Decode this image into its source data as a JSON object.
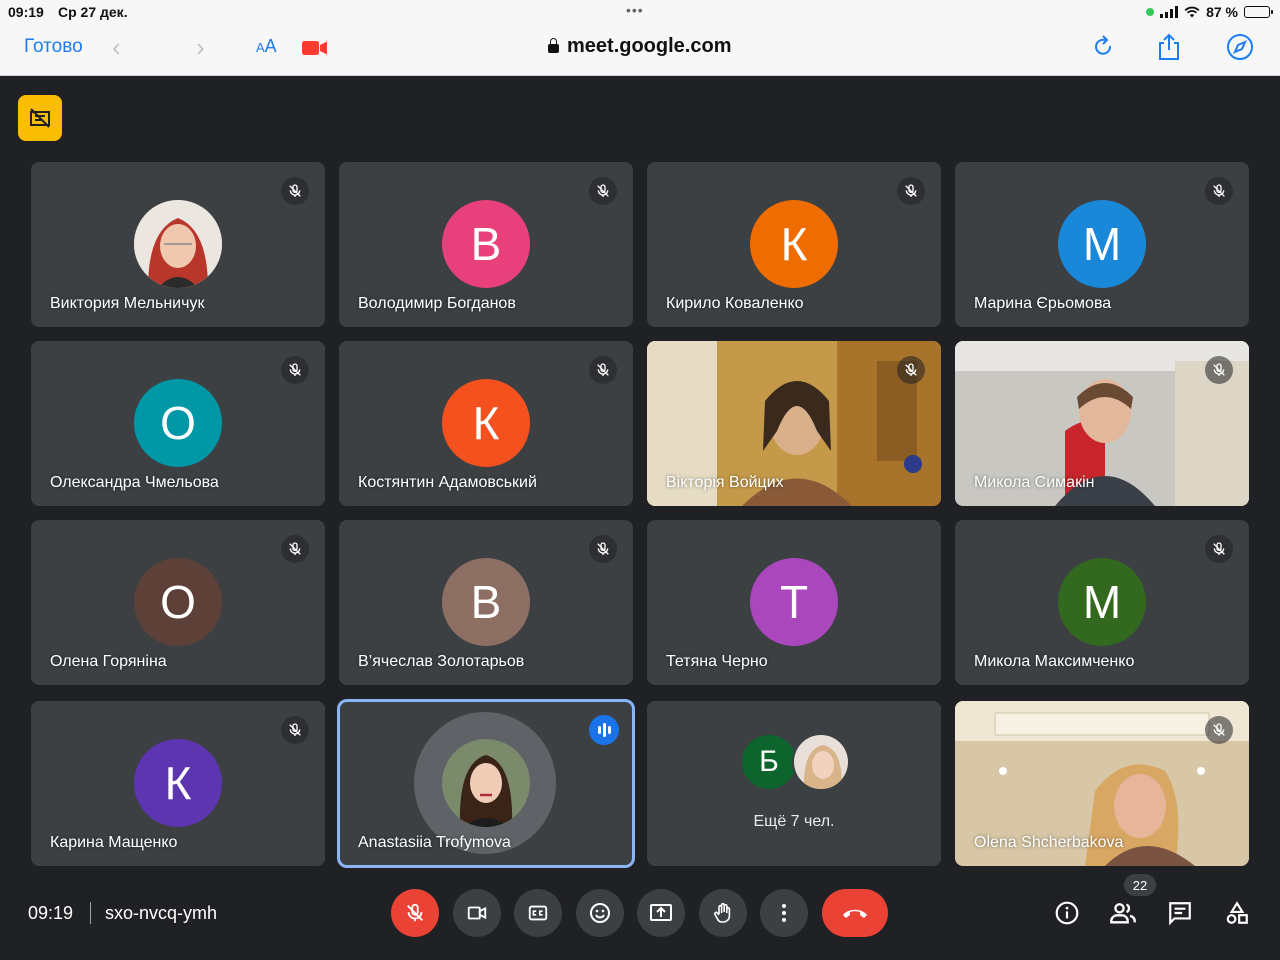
{
  "status_bar": {
    "time": "09:19",
    "date": "Ср 27 дек.",
    "dots": "•••",
    "battery": "87 %",
    "battery_level": 0.87
  },
  "browser": {
    "done_label": "Готово",
    "text_size_label": "AA",
    "url": "meet.google.com"
  },
  "tiles": [
    {
      "name": "Виктория Мельничук",
      "type": "photo",
      "muted": true
    },
    {
      "name": "Володимир Богданов",
      "type": "letter",
      "letter": "В",
      "color": "#e8407a",
      "muted": true
    },
    {
      "name": "Кирило Коваленко",
      "type": "letter",
      "letter": "К",
      "color": "#ef6c00",
      "muted": true
    },
    {
      "name": "Марина Єрьомова",
      "type": "letter",
      "letter": "М",
      "color": "#1a88d8",
      "muted": true
    },
    {
      "name": "Олександра Чмельова",
      "type": "letter",
      "letter": "О",
      "color": "#0097a7",
      "muted": true
    },
    {
      "name": "Костянтин Адамовський",
      "type": "letter",
      "letter": "К",
      "color": "#f4511e",
      "muted": true
    },
    {
      "name": "Вікторія Войцих",
      "type": "video",
      "muted": true
    },
    {
      "name": "Микола Симакін",
      "type": "video",
      "muted": true
    },
    {
      "name": "Олена Горяніна",
      "type": "letter",
      "letter": "О",
      "color": "#5d4037",
      "muted": true
    },
    {
      "name": "В’ячеслав Золотарьов",
      "type": "letter",
      "letter": "В",
      "color": "#8d6e63",
      "muted": true
    },
    {
      "name": "Тетяна Черно",
      "type": "letter",
      "letter": "Т",
      "color": "#ab47bc",
      "muted": false
    },
    {
      "name": "Микола Максимченко",
      "type": "letter",
      "letter": "М",
      "color": "#33691e",
      "muted": true
    },
    {
      "name": "Карина Мащенко",
      "type": "letter",
      "letter": "К",
      "color": "#5e35b1",
      "muted": true
    },
    {
      "name": "Anastasiia Trofymova",
      "type": "photo-speaking",
      "muted": false
    },
    {
      "name": "",
      "type": "more",
      "letter": "Б",
      "color": "#0d652d",
      "more_text": "Ещё 7 чел.",
      "muted": false
    },
    {
      "name": "Olena Shcherbakova",
      "type": "video",
      "muted": true
    }
  ],
  "bottom_bar": {
    "time": "09:19",
    "meeting_code": "sxo-nvcq-ymh",
    "participant_count": "22"
  },
  "colors": {
    "background": "#202124",
    "tile": "#3c4043",
    "danger": "#ea4335",
    "accent": "#1a73e8",
    "safari_blue": "#1e7cf2"
  }
}
